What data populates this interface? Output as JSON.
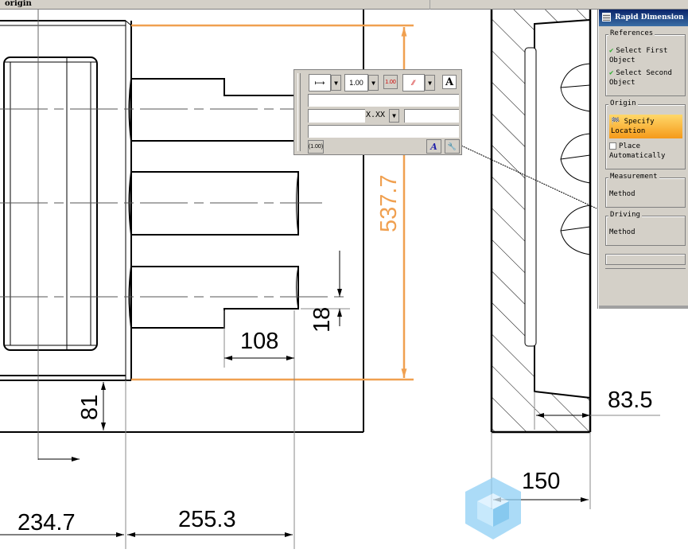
{
  "status_bar": {
    "prompt": "origin"
  },
  "drawing": {
    "accent_color": "#f0a050",
    "dimensions": {
      "height_highlighted": "537.7",
      "step_length": "108",
      "step_offset": "18",
      "bottom_offset": "81",
      "left_width": "234.7",
      "pin_span": "255.3",
      "section_inner": "83.5",
      "section_width": "150"
    }
  },
  "dimension_popup": {
    "style_icon": "dimension-style-icon",
    "precision_value": "1.00",
    "tolerance_icon": "tolerance-icon",
    "text_icon": "text-A-icon",
    "format_value": "X.XX",
    "reference_icon": "reference-1.00-icon",
    "text_settings_icon": "text-settings-icon",
    "settings_icon": "wrench-icon"
  },
  "dialog": {
    "title": "Rapid Dimension",
    "references": {
      "label": "References",
      "first": "Select First Object",
      "second": "Select Second Object"
    },
    "origin": {
      "label": "Origin",
      "specify": "Specify Location",
      "auto_place": "Place Automatically",
      "auto_place_checked": false
    },
    "measurement": {
      "label": "Measurement",
      "method": "Method"
    },
    "driving": {
      "label": "Driving",
      "method": "Method"
    }
  }
}
